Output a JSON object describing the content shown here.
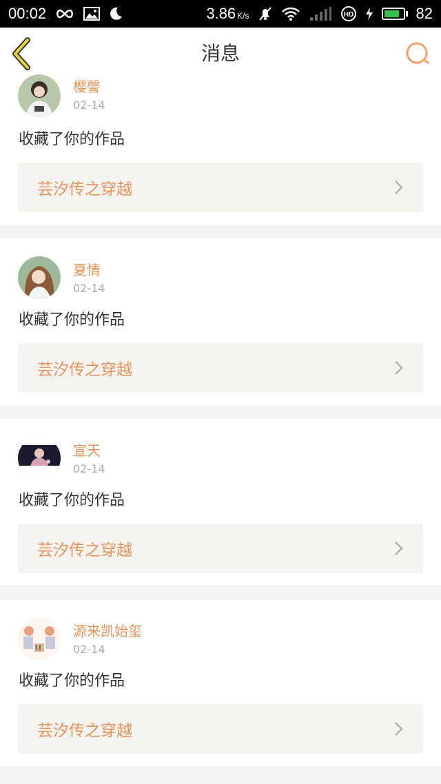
{
  "status_bar": {
    "time": "00:02",
    "speed": "3.86",
    "speed_unit": "K/s",
    "battery_percent_text": "82",
    "battery_level": 0.82,
    "icons": [
      "infinity-icon",
      "image-icon",
      "moon-icon",
      "mute-bell-icon",
      "wifi-icon",
      "signal-icon",
      "hd-icon",
      "charging-icon",
      "battery-icon"
    ]
  },
  "nav": {
    "title": "消息",
    "back_icon": "chevron-left-icon",
    "search_icon": "search-icon"
  },
  "colors": {
    "accent": "#e8935a",
    "back_icon": "#d8b820",
    "card_bg": "#f4f3ee",
    "page_bg": "#f5f5f5"
  },
  "messages": [
    {
      "name": "樱謦",
      "date": "02-14",
      "action": "收藏了你的作品",
      "work": "芸汐传之穿越"
    },
    {
      "name": "夏情",
      "date": "02-14",
      "action": "收藏了你的作品",
      "work": "芸汐传之穿越"
    },
    {
      "name": "宣天",
      "date": "02-14",
      "action": "收藏了你的作品",
      "work": "芸汐传之穿越"
    },
    {
      "name": "源来凯始玺",
      "date": "02-14",
      "action": "收藏了你的作品",
      "work": "芸汐传之穿越"
    }
  ]
}
